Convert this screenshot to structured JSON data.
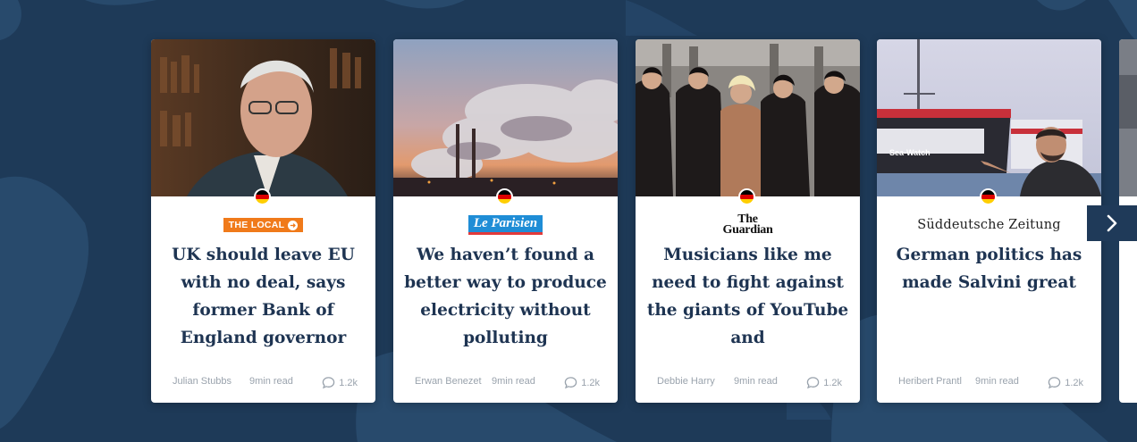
{
  "colors": {
    "background": "#1e3a58",
    "headline": "#1e3452",
    "meta": "#9aa3ad",
    "nav_button": "#1f3a59"
  },
  "cards": [
    {
      "country_flag": "germany-flag",
      "source_logo": "THE LOCAL",
      "headline": "UK should leave EU with no deal, says former Bank of England governor",
      "author": "Julian Stubbs",
      "read_time": "9min read",
      "comments": "1.2k"
    },
    {
      "country_flag": "germany-flag",
      "source_logo": "Le Parisien",
      "headline": "We haven’t found a better way to produce electricity without polluting",
      "author": "Erwan Benezet",
      "read_time": "9min read",
      "comments": "1.2k"
    },
    {
      "country_flag": "germany-flag",
      "source_logo_line1": "The",
      "source_logo_line2": "Guardian",
      "headline": "Musicians like me need to fight against the giants of YouTube and",
      "author": "Debbie Harry",
      "read_time": "9min read",
      "comments": "1.2k"
    },
    {
      "country_flag": "germany-flag",
      "source_logo": "Süddeutsche Zeitung",
      "headline": "German politics has made Salvini great",
      "author": "Heribert Prantl",
      "read_time": "9min read",
      "comments": "1.2k"
    }
  ],
  "photo_captions": {
    "ship_label": "Sea-Watch"
  },
  "nav": {
    "next_icon": "chevron-right-icon"
  }
}
